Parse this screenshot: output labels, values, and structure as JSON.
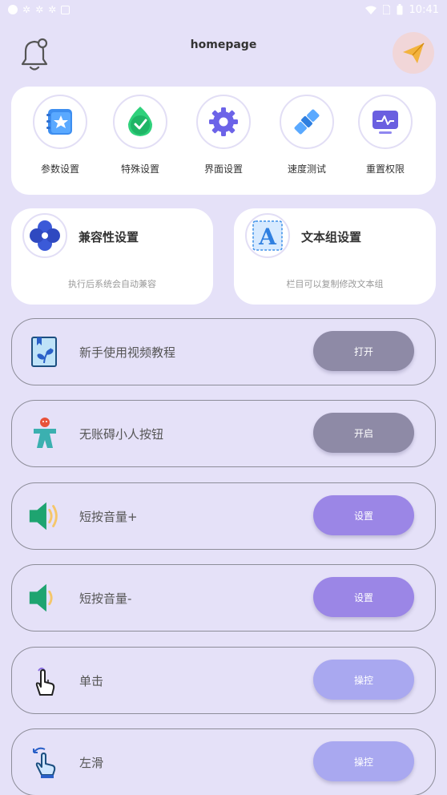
{
  "status_bar": {
    "time": "10:41"
  },
  "header": {
    "title": "homepage"
  },
  "tools": [
    {
      "label": "参数设置",
      "icon": "params-star-icon"
    },
    {
      "label": "特殊设置",
      "icon": "special-check-icon"
    },
    {
      "label": "界面设置",
      "icon": "interface-gear-icon"
    },
    {
      "label": "速度测试",
      "icon": "speed-satellite-icon"
    },
    {
      "label": "重置权限",
      "icon": "reset-monitor-icon"
    }
  ],
  "cards": [
    {
      "title": "兼容性设置",
      "subtitle": "执行后系统会自动兼容",
      "icon": "compat-flower-icon"
    },
    {
      "title": "文本组设置",
      "subtitle": "栏目可以复制修改文本组",
      "icon": "text-letter-a-icon"
    }
  ],
  "rows": [
    {
      "label": "新手使用视频教程",
      "button": "打开",
      "button_color": "#8e8aa6",
      "icon": "tutorial-book-icon"
    },
    {
      "label": "无账碍小人按钮",
      "button": "开启",
      "button_color": "#8e8aa6",
      "icon": "little-man-icon"
    },
    {
      "label": "短按音量+",
      "button": "设置",
      "button_color": "#9b86e6",
      "icon": "volume-up-icon"
    },
    {
      "label": "短按音量-",
      "button": "设置",
      "button_color": "#9b86e6",
      "icon": "volume-down-icon"
    },
    {
      "label": "单击",
      "button": "操控",
      "button_color": "#a9a8f0",
      "icon": "tap-hand-icon"
    },
    {
      "label": "左滑",
      "button": "操控",
      "button_color": "#a9a8f0",
      "icon": "swipe-hand-icon"
    }
  ]
}
